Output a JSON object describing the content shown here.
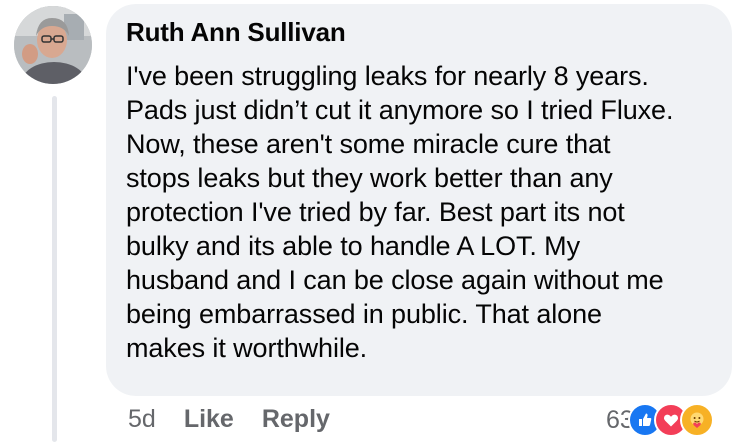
{
  "comment": {
    "author": "Ruth Ann Sullivan",
    "text": "I've been struggling leaks for nearly 8 years.\nPads just didn’t cut it anymore so I tried Fluxe.\nNow, these aren't some miracle cure that\nstops leaks but they work better than any\nprotection I've tried by far. Best part its not\nbulky and its able to handle A LOT. My\nhusband and I can be close again without me\nbeing embarrassed in public. That alone\nmakes it worthwhile.",
    "timestamp": "5d",
    "like_label": "Like",
    "reply_label": "Reply",
    "reaction_count": "63"
  },
  "reactions": [
    {
      "icon": "like-icon",
      "color": "#1877f2"
    },
    {
      "icon": "love-icon",
      "color": "#f33e58"
    },
    {
      "icon": "care-icon",
      "color": "#f7b125"
    }
  ],
  "colors": {
    "bubble": "#f0f2f5",
    "text": "#050505",
    "secondary_text": "#65676b",
    "thread_line": "#e4e6eb"
  }
}
